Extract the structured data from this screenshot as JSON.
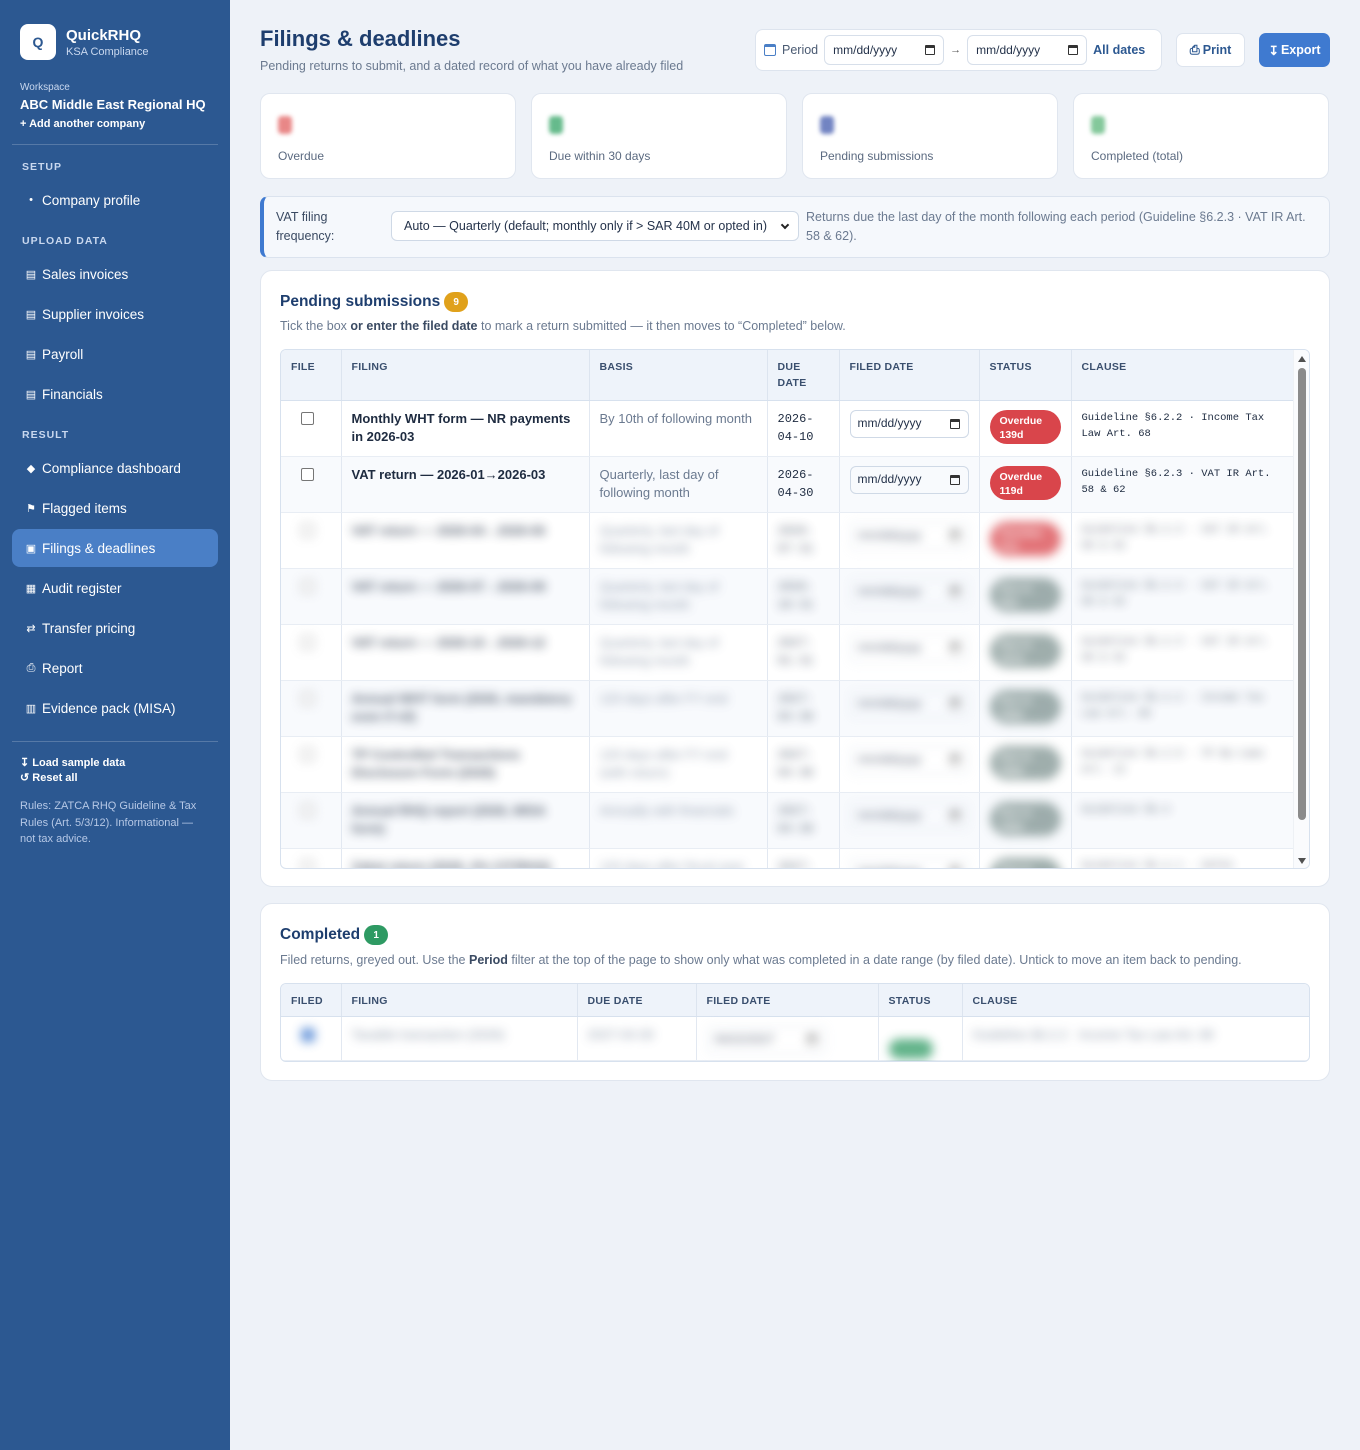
{
  "app": {
    "logo_letter": "Q",
    "name": "QuickRHQ",
    "subtitle": "KSA Compliance"
  },
  "workspace": {
    "label": "Workspace",
    "name": "ABC Middle East Regional HQ",
    "add_link": "+ Add another company"
  },
  "sidebar": {
    "sections": [
      {
        "title": "SETUP",
        "items": [
          {
            "icon": "•",
            "icon_name": "dot-icon",
            "label": "Company profile"
          }
        ]
      },
      {
        "title": "UPLOAD DATA",
        "items": [
          {
            "icon": "▤",
            "icon_name": "table-icon",
            "label": "Sales invoices"
          },
          {
            "icon": "▤",
            "icon_name": "table-icon",
            "label": "Supplier invoices"
          },
          {
            "icon": "▤",
            "icon_name": "table-icon",
            "label": "Payroll"
          },
          {
            "icon": "▤",
            "icon_name": "table-icon",
            "label": "Financials"
          }
        ]
      },
      {
        "title": "RESULT",
        "items": [
          {
            "icon": "◆",
            "icon_name": "diamond-icon",
            "label": "Compliance dashboard"
          },
          {
            "icon": "⚑",
            "icon_name": "flag-icon",
            "label": "Flagged items"
          },
          {
            "icon": "▣",
            "icon_name": "calendar-icon",
            "label": "Filings & deadlines",
            "active": true
          },
          {
            "icon": "▦",
            "icon_name": "grid-icon",
            "label": "Audit register"
          },
          {
            "icon": "⇄",
            "icon_name": "transfer-icon",
            "label": "Transfer pricing"
          },
          {
            "icon": "⎙",
            "icon_name": "print-icon",
            "label": "Report"
          },
          {
            "icon": "▥",
            "icon_name": "clipboard-icon",
            "label": "Evidence pack (MISA)"
          }
        ]
      }
    ],
    "footer": {
      "load_sample": "↧ Load sample data",
      "reset": "↺ Reset all",
      "note": "Rules: ZATCA RHQ Guideline & Tax Rules (Art. 5/3/12). Informational — not tax advice."
    }
  },
  "header": {
    "title": "Filings & deadlines",
    "subtitle": "Pending returns to submit, and a dated record of what you have already filed",
    "period_label": "Period",
    "date_from_placeholder": "mm/dd/yyyy",
    "date_to_placeholder": "mm/dd/yyyy",
    "arrow": "→",
    "all_dates": "All dates",
    "print_label": "Print",
    "export_label": "Export"
  },
  "kpis": [
    {
      "label": "Overdue",
      "color": "#e57373"
    },
    {
      "label": "Due within 30 days",
      "color": "#4caf78"
    },
    {
      "label": "Pending submissions",
      "color": "#5a6fb8"
    },
    {
      "label": "Completed (total)",
      "color": "#6fbf8a"
    }
  ],
  "frequency": {
    "label": "VAT filing frequency:",
    "selected": "Auto — Quarterly (default; monthly only if > SAR 40M or opted in)",
    "note": "Returns due the last day of the month following each period (Guideline §6.2.3 · VAT IR Art. 58 & 62)."
  },
  "pending": {
    "title": "Pending submissions",
    "count": "9",
    "desc_pre": "Tick the box ",
    "desc_bold": "or enter the filed date",
    "desc_post": " to mark a return submitted — it then moves to “Completed” below.",
    "columns": [
      "FILE",
      "FILING",
      "BASIS",
      "DUE DATE",
      "FILED DATE",
      "STATUS",
      "CLAUSE"
    ],
    "rows": [
      {
        "filing": "Monthly WHT form — NR payments in 2026-03",
        "basis": "By 10th of following month",
        "due": "2026-04-10",
        "filed_placeholder": "mm/dd/yyyy",
        "status": "Overdue 139d",
        "status_color": "red",
        "clause": "Guideline §6.2.2 · Income Tax Law Art. 68"
      },
      {
        "filing": "VAT return — 2026-01→2026-03",
        "basis": "Quarterly, last day of following month",
        "due": "2026-04-30",
        "filed_placeholder": "mm/dd/yyyy",
        "status": "Overdue 119d",
        "status_color": "red",
        "clause": "Guideline §6.2.3 · VAT IR Art. 58 & 62"
      },
      {
        "filing": "VAT return — 2026-04→2026-06",
        "basis": "Quarterly, last day of following month",
        "due": "2026-07-31",
        "filed_placeholder": "mm/dd/yyyy",
        "status": "Overdue 27d",
        "status_color": "red",
        "clause": "Guideline §6.2.3 · VAT IR Art. 58 & 62"
      },
      {
        "filing": "VAT return — 2026-07→2026-09",
        "basis": "Quarterly, last day of following month",
        "due": "2026-10-31",
        "filed_placeholder": "mm/dd/yyyy",
        "status": "Due in 65d",
        "status_color": "grey",
        "clause": "Guideline §6.2.3 · VAT IR Art. 58 & 62"
      },
      {
        "filing": "VAT return — 2026-10→2026-12",
        "basis": "Quarterly, last day of following month",
        "due": "2027-01-31",
        "filed_placeholder": "mm/dd/yyyy",
        "status": "Due in 157d",
        "status_color": "grey",
        "clause": "Guideline §6.2.3 · VAT IR Art. 58 & 62"
      },
      {
        "filing": "Annual WHT form (2026, mandatory even if nil)",
        "basis": "120 days after FY end",
        "due": "2027-04-30",
        "filed_placeholder": "mm/dd/yyyy",
        "status": "Due in 246d",
        "status_color": "grey",
        "clause": "Guideline §6.2.2 · Income Tax Law Art. 68"
      },
      {
        "filing": "TP Controlled Transactions Disclosure Form (2026)",
        "basis": "120 days after FY end (with return)",
        "due": "2027-04-30",
        "filed_placeholder": "mm/dd/yyyy",
        "status": "Due in 246d",
        "status_color": "grey",
        "clause": "Guideline §6.2.5 · TP By-Laws Art. 12"
      },
      {
        "filing": "Annual RHQ report (2026, MISA form)",
        "basis": "Annually with financials",
        "due": "2027-04-30",
        "filed_placeholder": "mm/dd/yyyy",
        "status": "Due in 246d",
        "status_color": "grey",
        "clause": "Guideline §6.4"
      },
      {
        "filing": "Zakat return (2026, 0% CIT/RHQ)",
        "basis": "120 days after fiscal year end",
        "due": "2027-04-30",
        "filed_placeholder": "mm/dd/yyyy",
        "status": "Due in 246d",
        "status_color": "grey",
        "clause": "Guideline §6.2.1 · ZATCA"
      }
    ]
  },
  "completed": {
    "title": "Completed",
    "count": "1",
    "desc_pre": "Filed returns, greyed out. Use the ",
    "desc_bold": "Period",
    "desc_post": " filter at the top of the page to show only what was completed in a date range (by filed date). Untick to move an item back to pending.",
    "columns": [
      "FILED",
      "FILING",
      "DUE DATE",
      "FILED DATE",
      "STATUS",
      "CLAUSE"
    ],
    "rows": [
      {
        "filing": "Taxable transaction (2026)",
        "due": "2027-04-30",
        "filed": "04/22/2027",
        "status": "Filed",
        "clause": "Guideline §6.2.2 · Income Tax Law Art. 68"
      }
    ]
  }
}
